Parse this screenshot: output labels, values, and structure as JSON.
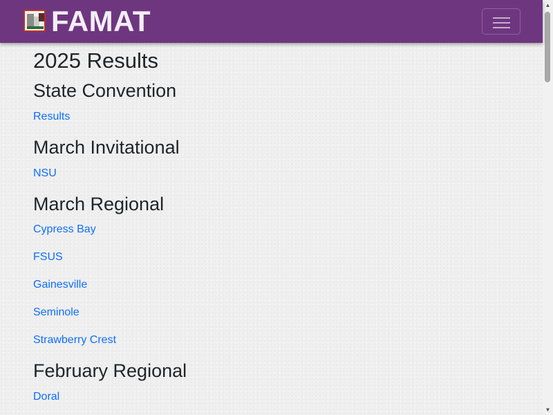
{
  "brand": {
    "name": "FAMAT"
  },
  "page": {
    "title": "2025 Results"
  },
  "sections": [
    {
      "heading": "State Convention",
      "links": [
        "Results"
      ]
    },
    {
      "heading": "March Invitational",
      "links": [
        "NSU"
      ]
    },
    {
      "heading": "March Regional",
      "links": [
        "Cypress Bay",
        "FSUS",
        "Gainesville",
        "Seminole",
        "Strawberry Crest"
      ]
    },
    {
      "heading": "February Regional",
      "links": [
        "Doral"
      ]
    }
  ],
  "colors": {
    "navbar": "#6f3680",
    "link": "#0d6efd",
    "heading": "#212529",
    "background": "#efefef"
  },
  "icons": {
    "menu": "hamburger-icon",
    "scroll_up": "arrow-up-icon",
    "scroll_down": "arrow-down-icon"
  }
}
